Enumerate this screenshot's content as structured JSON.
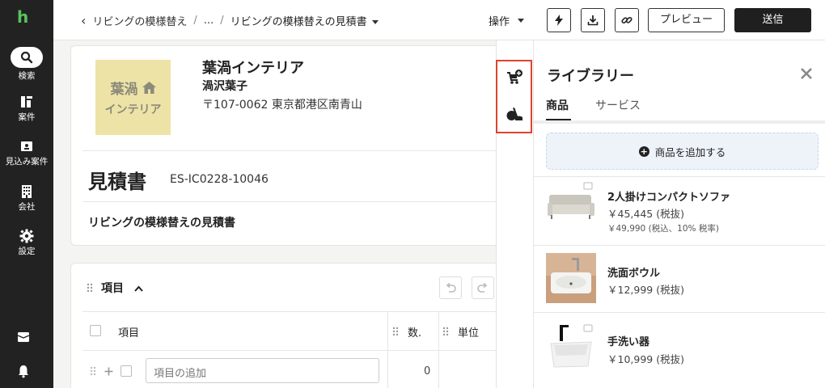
{
  "nav": {
    "logo": "h",
    "search": "検索",
    "cases": "案件",
    "leads": "見込み案件",
    "companies": "会社",
    "settings": "設定"
  },
  "topbar": {
    "back": "‹",
    "breadcrumb_parent": "リビングの模様替え",
    "breadcrumb_sep": "/",
    "breadcrumb_ellipsis": "...",
    "breadcrumb_current": "リビングの模様替えの見積書",
    "operations": "操作",
    "preview": "プレビュー",
    "send": "送信"
  },
  "document": {
    "logo_line1": "葉渦",
    "logo_line2": "インテリア",
    "company_name": "葉渦インテリア",
    "contact_person": "渦沢葉子",
    "address": "〒107-0062 東京都港区南青山",
    "title": "見積書",
    "number": "ES-IC0228-10046",
    "subject": "リビングの模様替えの見積書"
  },
  "items": {
    "title": "項目",
    "col_item": "項目",
    "col_qty": "数.",
    "col_unit": "単位",
    "add_placeholder": "項目の追加",
    "qty_value": "0"
  },
  "library": {
    "title": "ライブラリー",
    "tabs": [
      {
        "label": "商品",
        "active": true
      },
      {
        "label": "サービス",
        "active": false
      }
    ],
    "add_product": "商品を追加する",
    "products": [
      {
        "name": "2人掛けコンパクトソファ",
        "price": "￥45,445 (税抜)",
        "price_tax": "￥49,990 (税込、10% 税率)",
        "image": "sofa"
      },
      {
        "name": "洗面ボウル",
        "price": "￥12,999 (税抜)",
        "image": "basin"
      },
      {
        "name": "手洗い器",
        "price": "￥10,999 (税抜)",
        "image": "hand-wash-sink"
      }
    ]
  },
  "colors": {
    "nav_bg": "#222222",
    "brand_green": "#58c45e",
    "highlight": "#e0432f",
    "logo_bg": "#ede3a7",
    "add_product_bg": "#eef3fa"
  }
}
